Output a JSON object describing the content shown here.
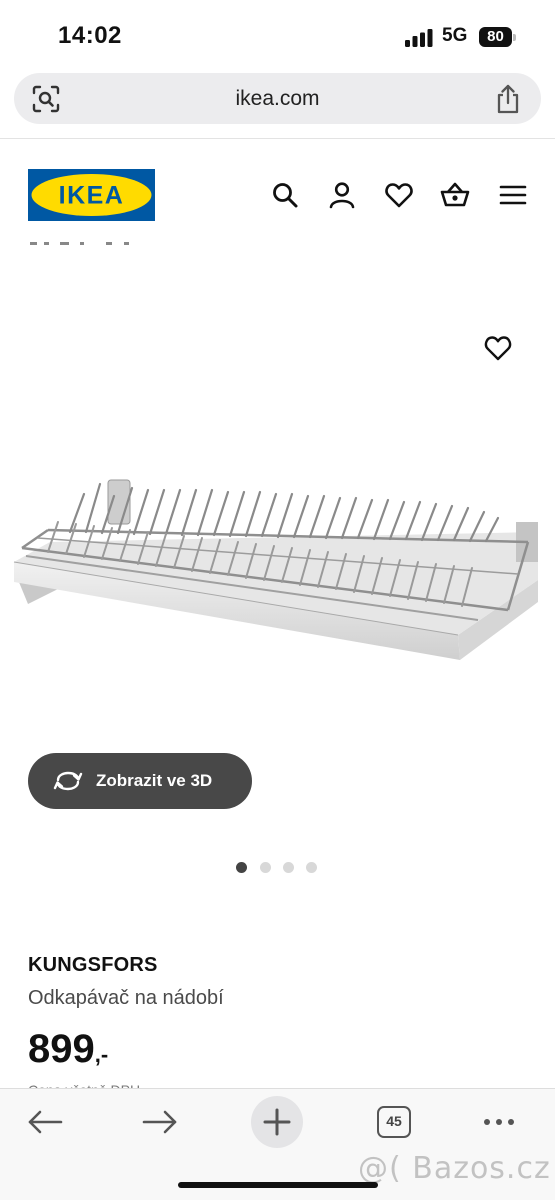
{
  "status_bar": {
    "time": "14:02",
    "network": "5G",
    "battery": "80"
  },
  "browser": {
    "url": "ikea.com",
    "tabs_count": "45"
  },
  "header": {
    "logo_text": "IKEA"
  },
  "product_media": {
    "view_3d_label": "Zobrazit ve 3D",
    "image_count": 4,
    "active_image": 1
  },
  "product": {
    "name": "KUNGSFORS",
    "description": "Odkapávač na nádobí",
    "price": "899",
    "price_suffix": ",-",
    "price_note": "Cena včetně DPH"
  },
  "watermark": "@( Bazos.cz",
  "colors": {
    "ikea_blue": "#0058a3",
    "ikea_yellow": "#ffdb00",
    "button_dark": "#484848"
  }
}
